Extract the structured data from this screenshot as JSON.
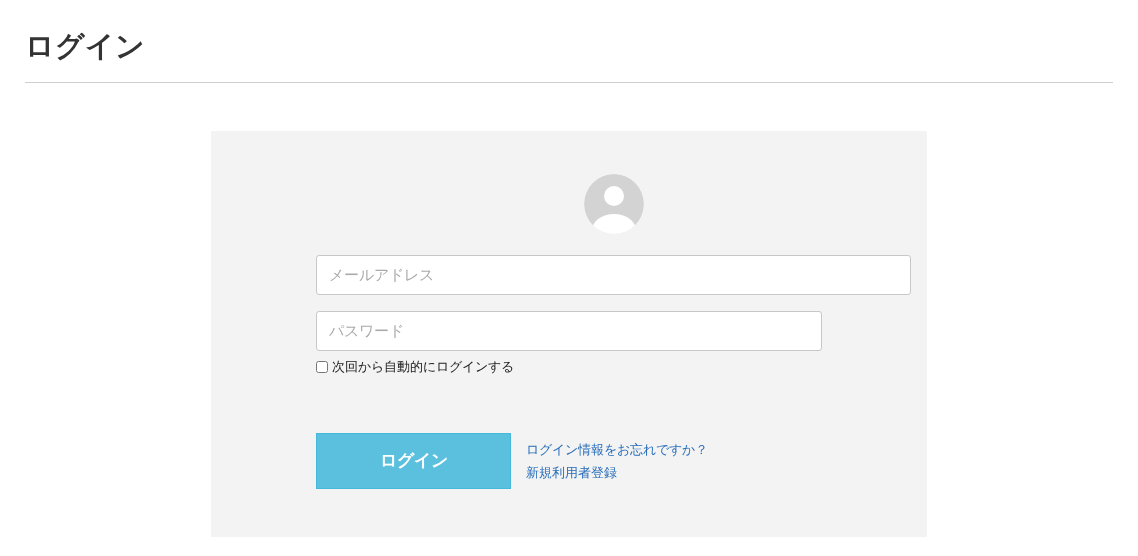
{
  "page_title": "ログイン",
  "form": {
    "email": {
      "placeholder": "メールアドレス"
    },
    "password": {
      "placeholder": "パスワード"
    },
    "remember": {
      "label": "次回から自動的にログインする",
      "checked": false
    },
    "submit": "ログイン",
    "links": [
      "ログイン情報をお忘れですか？",
      "新規利用者登録"
    ]
  }
}
